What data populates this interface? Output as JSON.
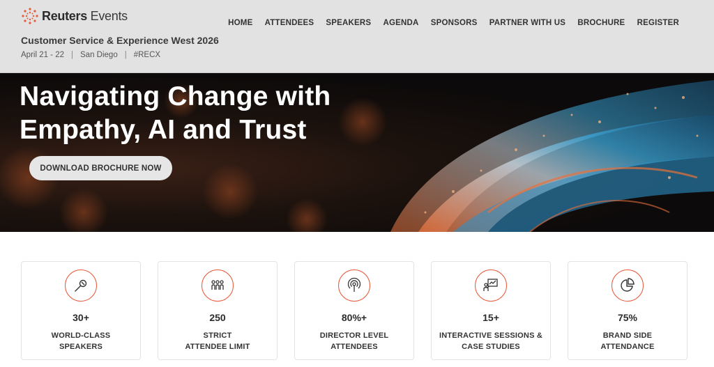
{
  "header": {
    "logo": {
      "brand_bold": "Reuters",
      "brand_light": " Events"
    },
    "event_title": "Customer Service & Experience West 2026",
    "meta": {
      "dates": "April 21 - 22",
      "sep1": "|",
      "location": "San Diego",
      "sep2": "|",
      "hashtag": "#RECX"
    },
    "nav": [
      "HOME",
      "ATTENDEES",
      "SPEAKERS",
      "AGENDA",
      "SPONSORS",
      "PARTNER WITH US",
      "BROCHURE",
      "REGISTER"
    ]
  },
  "hero": {
    "title_line1": "Navigating Change with",
    "title_line2": "Empathy, AI and Trust",
    "button_label": "DOWNLOAD BROCHURE NOW"
  },
  "stats": [
    {
      "icon": "microphone-icon",
      "value": "30+",
      "label_line1": "WORLD-CLASS",
      "label_line2": "SPEAKERS"
    },
    {
      "icon": "people-icon",
      "value": "250",
      "label_line1": "STRICT",
      "label_line2": "ATTENDEE LIMIT"
    },
    {
      "icon": "broadcast-icon",
      "value": "80%+",
      "label_line1": "DIRECTOR LEVEL",
      "label_line2": "ATTENDEES"
    },
    {
      "icon": "presentation-icon",
      "value": "15+",
      "label_line1": "INTERACTIVE SESSIONS &",
      "label_line2": "CASE STUDIES"
    },
    {
      "icon": "pie-chart-icon",
      "value": "75%",
      "label_line1": "BRAND SIDE",
      "label_line2": "ATTENDANCE"
    }
  ],
  "colors": {
    "accent": "#e8593a",
    "header_bg": "#e2e2e2",
    "hero_blue": "#3aa6d8",
    "hero_orange": "#e8703a"
  }
}
